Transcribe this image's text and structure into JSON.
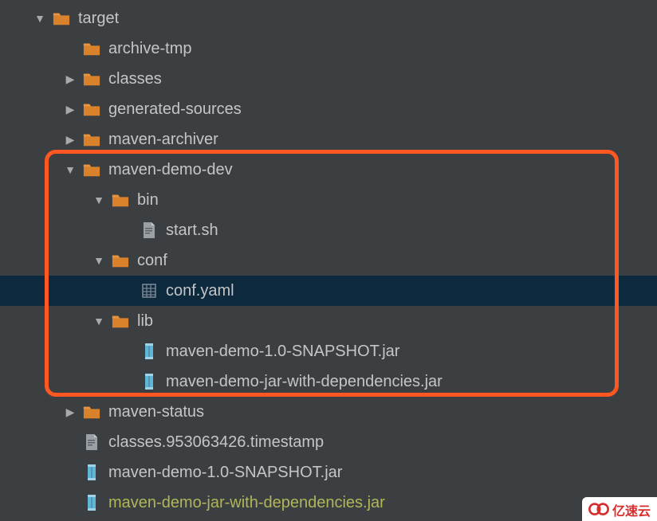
{
  "tree": {
    "items": [
      {
        "indent": 40,
        "arrow": "down",
        "icon": "folder",
        "label": "target",
        "highlight": false,
        "selected": false
      },
      {
        "indent": 78,
        "arrow": "none",
        "icon": "folder",
        "label": "archive-tmp",
        "highlight": false,
        "selected": false
      },
      {
        "indent": 78,
        "arrow": "right",
        "icon": "folder",
        "label": "classes",
        "highlight": false,
        "selected": false
      },
      {
        "indent": 78,
        "arrow": "right",
        "icon": "folder",
        "label": "generated-sources",
        "highlight": false,
        "selected": false
      },
      {
        "indent": 78,
        "arrow": "right",
        "icon": "folder",
        "label": "maven-archiver",
        "highlight": false,
        "selected": false
      },
      {
        "indent": 78,
        "arrow": "down",
        "icon": "folder",
        "label": "maven-demo-dev",
        "highlight": false,
        "selected": false
      },
      {
        "indent": 114,
        "arrow": "down",
        "icon": "folder",
        "label": "bin",
        "highlight": false,
        "selected": false
      },
      {
        "indent": 150,
        "arrow": "none",
        "icon": "file",
        "label": "start.sh",
        "highlight": false,
        "selected": false
      },
      {
        "indent": 114,
        "arrow": "down",
        "icon": "folder",
        "label": "conf",
        "highlight": false,
        "selected": false
      },
      {
        "indent": 150,
        "arrow": "none",
        "icon": "yaml",
        "label": "conf.yaml",
        "highlight": false,
        "selected": true
      },
      {
        "indent": 114,
        "arrow": "down",
        "icon": "folder",
        "label": "lib",
        "highlight": false,
        "selected": false
      },
      {
        "indent": 150,
        "arrow": "none",
        "icon": "jar",
        "label": "maven-demo-1.0-SNAPSHOT.jar",
        "highlight": false,
        "selected": false
      },
      {
        "indent": 150,
        "arrow": "none",
        "icon": "jar",
        "label": "maven-demo-jar-with-dependencies.jar",
        "highlight": false,
        "selected": false
      },
      {
        "indent": 78,
        "arrow": "right",
        "icon": "folder",
        "label": "maven-status",
        "highlight": false,
        "selected": false
      },
      {
        "indent": 78,
        "arrow": "none",
        "icon": "file",
        "label": "classes.953063426.timestamp",
        "highlight": false,
        "selected": false
      },
      {
        "indent": 78,
        "arrow": "none",
        "icon": "jar",
        "label": "maven-demo-1.0-SNAPSHOT.jar",
        "highlight": false,
        "selected": false
      },
      {
        "indent": 78,
        "arrow": "none",
        "icon": "jar",
        "label": "maven-demo-jar-with-dependencies.jar",
        "highlight": true,
        "selected": false
      }
    ]
  },
  "watermark": {
    "text": "亿速云"
  }
}
